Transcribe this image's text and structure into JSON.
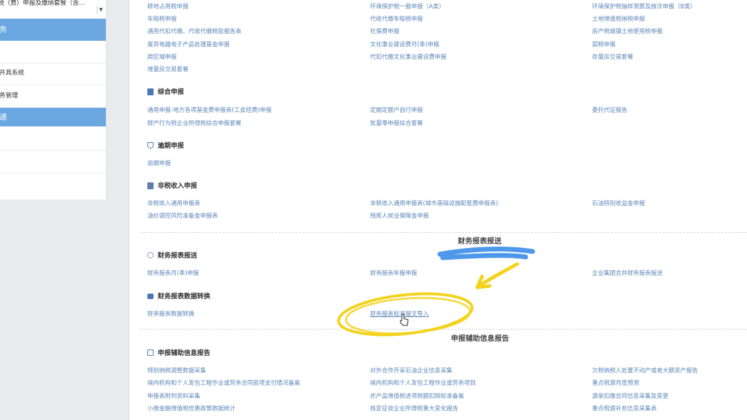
{
  "sidebar": {
    "dropdown_text": "税（费）申报及缴纳套餐（含...",
    "dropdown_arrow": "▼",
    "items": [
      {
        "label": "务",
        "active": true
      },
      {
        "label": "",
        "active": false
      },
      {
        "label": "开具系统",
        "active": false
      },
      {
        "label": "务管理",
        "active": false
      },
      {
        "label": "递",
        "active": true
      },
      {
        "label": "",
        "active": false
      },
      {
        "label": "",
        "active": false
      }
    ]
  },
  "top_links": [
    [
      "耕地占用税申报",
      "环境保护税一般申报（A类）",
      "环境保护税抽样测算及按次申报（B类）"
    ],
    [
      "车船税申报",
      "代收代缴车船税申报",
      "土地增值税纳税申报"
    ],
    [
      "通用代扣代缴、代收代缴税款报告表",
      "社保费申报",
      "房产税城镇土地使用税申报"
    ],
    [
      "废弃电器电子产品处理基金申报",
      "文化事业建设费月(季)申报",
      "契税申报"
    ],
    [
      "跨区域申报",
      "代扣代缴文化事业建设费申报",
      "存量房交易套餐"
    ],
    [
      "增量房交易套餐",
      "",
      ""
    ]
  ],
  "sections": {
    "comprehensive": {
      "title": "综合申报",
      "links": [
        [
          "通用申报-地方各项基金费申报表(工会经费)申报",
          "定期定额户自行申报",
          "委托代征报告"
        ],
        [
          "财产行为税企业所得税综合申报套餐",
          "批量零申报综合套餐",
          ""
        ]
      ]
    },
    "overdue": {
      "title": "逾期申报",
      "links": [
        [
          "逾期申报",
          "",
          ""
        ]
      ]
    },
    "nontax": {
      "title": "非税收入申报",
      "links": [
        [
          "非税收入通用申报表",
          "非税收入通用申报表(城市基础设施配套费申报表)",
          "石油特别收益金申报"
        ],
        [
          "油价调控风险准备金申报表",
          "残疾人就业保障金申报",
          ""
        ]
      ]
    },
    "finance_group_title": "财务报表报送",
    "finance_send": {
      "title": "财务报表报送",
      "links": [
        [
          "财务报表月(季)申报",
          "财务报表年报申报",
          "企业集团合并财务报表报送"
        ]
      ]
    },
    "finance_convert": {
      "title": "财务报表数据转换",
      "links": [
        [
          "财务报表数据转换",
          "财务报表标准报文导入",
          ""
        ]
      ]
    },
    "aux_group_title": "申报辅助信息报告",
    "aux": {
      "title": "申报辅助信息报告",
      "links": [
        [
          "特别纳税调整数据采集",
          "对外合作开采石油企业信息采集",
          "欠税纳税人处置不动产或者大额资产报告"
        ],
        [
          "境内机构和个人发包工程作业或劳务合同款项支付情况备案",
          "境内机构和个人发包工程作业或劳务项目",
          "重点税源月度预测"
        ],
        [
          "申报表附列资料采集",
          "农产品增值税进项税额扣除标准备案",
          "源泉扣缴合同信息采集及变更"
        ],
        [
          "小微金融增值税优惠政策数据统计",
          "核定征收企业所得税重大变化报告",
          "重点税源补充信息采集表"
        ]
      ]
    }
  },
  "colors": {
    "link": "#5b86b8",
    "sidebar_active": "#6aa6df",
    "highlight_blue": "#2f86e8",
    "highlight_yellow": "#f4d21a"
  }
}
